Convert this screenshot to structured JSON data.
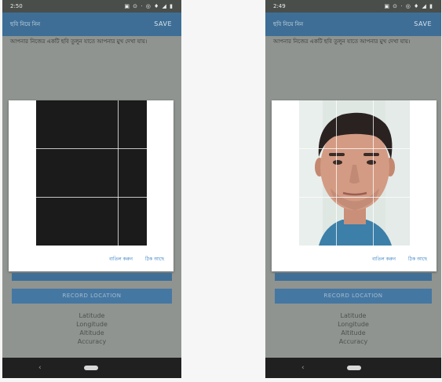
{
  "screen_left": {
    "status": {
      "time": "2:50",
      "icons": "▣ ⊙ · ◎ ♦ ◢ ▮"
    },
    "appbar": {
      "title": "ছবি নিয়ে নিন",
      "save_label": "SAVE"
    },
    "prompt": "আপনার নিজের একটি ছবি তুলুন যাতে আপনার মুখ দেখা যায়।",
    "dialog": {
      "cancel_label": "বাতিল করুন",
      "ok_label": "ঠিক আছে"
    },
    "record_location_label": "RECORD LOCATION",
    "coords": [
      "Latitude",
      "Longitude",
      "Altitude",
      "Accuracy"
    ]
  },
  "screen_right": {
    "status": {
      "time": "2:49",
      "icons": "▣ ⊙ · ◎ ♦ ◢ ▮"
    },
    "appbar": {
      "title": "ছবি নিয়ে নিন",
      "save_label": "SAVE"
    },
    "prompt": "আপনার নিজের একটি ছবি তুলুন যাতে আপনার মুখ দেখা যায়।",
    "dialog": {
      "cancel_label": "বাতিল করুন",
      "ok_label": "ঠিক আছে"
    },
    "record_location_label": "RECORD LOCATION",
    "coords": [
      "Latitude",
      "Longitude",
      "Altitude",
      "Accuracy"
    ]
  }
}
